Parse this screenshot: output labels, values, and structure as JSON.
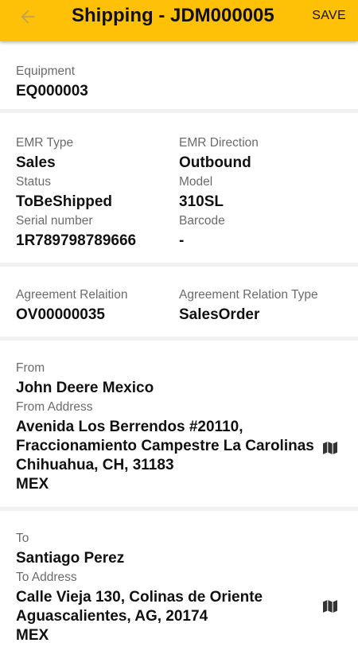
{
  "header": {
    "title": "Shipping - JDM000005",
    "save_label": "SAVE"
  },
  "equipment": {
    "label": "Equipment",
    "value": "EQ000003"
  },
  "details": {
    "emr_type_label": "EMR Type",
    "emr_type": "Sales",
    "emr_direction_label": "EMR Direction",
    "emr_direction": "Outbound",
    "status_label": "Status",
    "status": "ToBeShipped",
    "model_label": "Model",
    "model": "310SL",
    "serial_label": "Serial number",
    "serial": "1R789798789666",
    "barcode_label": "Barcode",
    "barcode": "-"
  },
  "agreement": {
    "relation_label": "Agreement Relaition",
    "relation": "OV00000035",
    "relation_type_label": "Agreement Relation Type",
    "relation_type": "SalesOrder"
  },
  "from": {
    "label": "From",
    "name": "John Deere Mexico",
    "address_label": "From Address",
    "address_lines": [
      "Avenida Los Berrendos #20110,",
      "Fraccionamiento Campestre La Carolinas",
      "Chihuahua, CH, 31183",
      "MEX"
    ]
  },
  "to": {
    "label": "To",
    "name": "Santiago Perez",
    "address_label": "To Address",
    "address_lines": [
      "Calle Vieja 130, Colinas de Oriente",
      "Aguascalientes, AG, 20174",
      "MEX"
    ]
  },
  "icons": {
    "back": "arrow-left-icon",
    "map": "map-icon"
  },
  "colors": {
    "appbar": "#FFC107",
    "label": "#6b6b6b",
    "divider": "#f1f1f1"
  }
}
